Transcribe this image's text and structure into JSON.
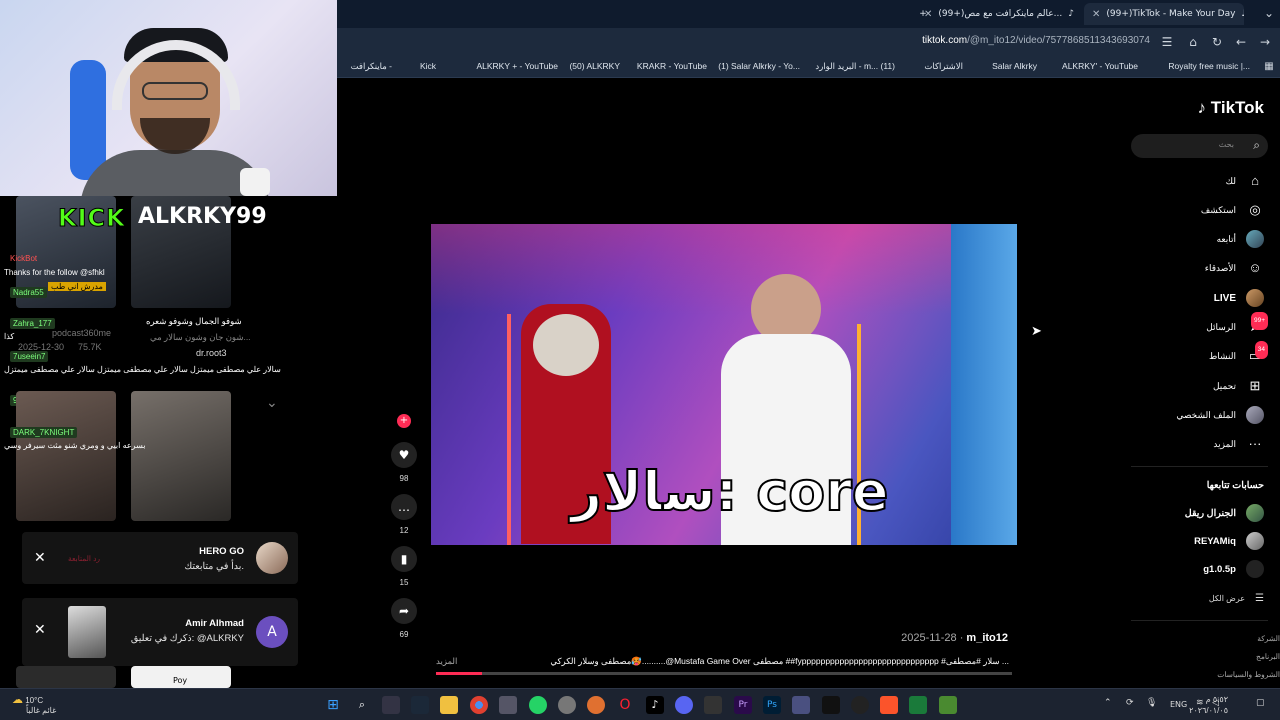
{
  "browser": {
    "tabs": [
      {
        "title": "(99+)TikTok - Make Your Day",
        "active": true
      },
      {
        "title": "(99+)عالم ماينكرافت مع مص...",
        "active": false
      }
    ],
    "new_tab": "+",
    "url_host": "tiktok.com",
    "url_path": "/@m_ito12/video/7577868511343693074",
    "bookmarks": [
      "Royalty free music |...",
      "ALKRKY' - YouTube",
      "Salar Alkrky",
      "الاشتراكات",
      "البريد الوارد - m... (11)",
      "(1) Salar Alkrky - Yo...",
      "KRAKR - YouTube",
      "(50) ALKRKY",
      "ALKRKY + - YouTube",
      "Kick",
      "ماينكرافت -"
    ]
  },
  "stream_overlay": {
    "kick_text": "KICK",
    "alkrky_text": "ALKRKY99",
    "chat": [
      {
        "user": "KickBot",
        "text": "Thanks for the follow @sfhkl"
      },
      {
        "user": "Nadra55",
        "text": "مدرش اني طب"
      },
      {
        "user": "Zahra_177",
        "text": "كذا"
      },
      {
        "user": "7useein7",
        "text": "سالار علي مصطفى ميمتزل سالار علي مصطفى ميمتزل سالار علي مصطفى ميمتزل"
      },
      {
        "user": "975286",
        "text": ""
      },
      {
        "user": "DARK_7KNIGHT",
        "text": "بسرعه ابيي و ومري شنو مثت سيرفر وسي"
      }
    ],
    "under_thumb_1": "شوفو الجمال وشوفو شعره",
    "under_thumb_1b": "شون جان وشون سالار مي...",
    "user_1": "dr.root3",
    "user_2": "podcast360me",
    "date_1": "2025-12-30",
    "views_1": "75.7K",
    "poy": "Poy"
  },
  "notifications": [
    {
      "name": "HERO GO",
      "text": "بدأ في متابعتك.",
      "action": "رد المتابعة"
    },
    {
      "name": "Amir Alhmad",
      "text": "ذكرك في تعليق: @ALKRKY",
      "avatar_letter": "A"
    }
  ],
  "video": {
    "caption": "سالار: core",
    "likes": "98",
    "comments": "12",
    "saves": "15",
    "shares": "69",
    "author": "m_ito12",
    "date": "2025-11-28",
    "description": "مصطفى وسلار الكركي🥵..........@Mustafa Game Over مصطفى ##fyppppppppppppppppppppppppppppp #سلار #مصطفى ...",
    "more": "المزيد",
    "progress_pct": 8
  },
  "tiktok": {
    "logo": "TikTok",
    "search_placeholder": "بحث",
    "nav": [
      {
        "label": "لك",
        "icon": "home-icon"
      },
      {
        "label": "استكشف",
        "icon": "compass-icon"
      },
      {
        "label": "أتابعه",
        "icon": "avatar-icon"
      },
      {
        "label": "الأصدقاء",
        "icon": "friends-icon"
      },
      {
        "label": "LIVE",
        "icon": "live-icon"
      },
      {
        "label": "الرسائل",
        "icon": "messages-icon",
        "badge": "99+"
      },
      {
        "label": "النشاط",
        "icon": "activity-icon",
        "badge": "34"
      },
      {
        "label": "تحميل",
        "icon": "upload-icon"
      },
      {
        "label": "الملف الشخصي",
        "icon": "profile-icon"
      },
      {
        "label": "المزيد",
        "icon": "more-icon"
      }
    ],
    "following_title": "حسابات تتابعها",
    "following": [
      "الجنرال ريقل",
      "REYAMiq",
      "g1.0.5p"
    ],
    "see_all": "عرض الكل",
    "footer": [
      "الشركة",
      "البرنامج",
      "الشروط والسياسات"
    ]
  },
  "taskbar": {
    "temp": "10°C",
    "weather_text": "غائم غالباً",
    "lang": "ENG",
    "time": "٥:٥٢ م",
    "date": "٢٠٢٦/٠١/٠٥"
  }
}
